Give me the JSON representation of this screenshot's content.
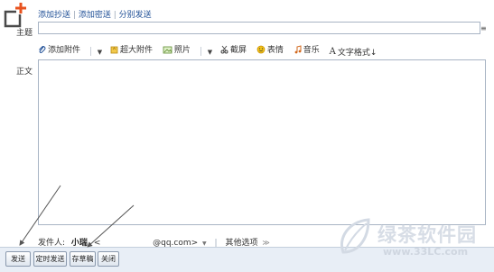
{
  "links": {
    "add_cc": "添加抄送",
    "add_bcc": "添加密送",
    "separate_send": "分别发送",
    "separator": "|"
  },
  "subject": {
    "label": "主题",
    "value": "",
    "dropdown_icon": "≡"
  },
  "toolbar": {
    "attach": "添加附件",
    "large_attach": "超大附件",
    "photo": "照片",
    "screenshot": "截屏",
    "emoji": "表情",
    "music": "音乐",
    "text_format": "文字格式↓"
  },
  "body": {
    "label": "正文",
    "value": ""
  },
  "sender": {
    "label": "发件人:",
    "name": "小瑞",
    "open_angle": "<",
    "email_domain": "@qq.com>",
    "dropdown": "▼",
    "separator": "|",
    "more_options": "其他选项",
    "more_icon": "≫"
  },
  "buttons": {
    "send": "发送",
    "timed_send": "定时发送",
    "save_draft": "存草稿",
    "close": "关闭"
  },
  "watermark": {
    "text": "绿茶软件园",
    "url": "www.33LC.com"
  },
  "colors": {
    "link": "#1f4f96",
    "border": "#a8b4c4",
    "bottom_bar": "#e8eef6",
    "logo_accent": "#e8531f",
    "arrow": "#555555"
  }
}
